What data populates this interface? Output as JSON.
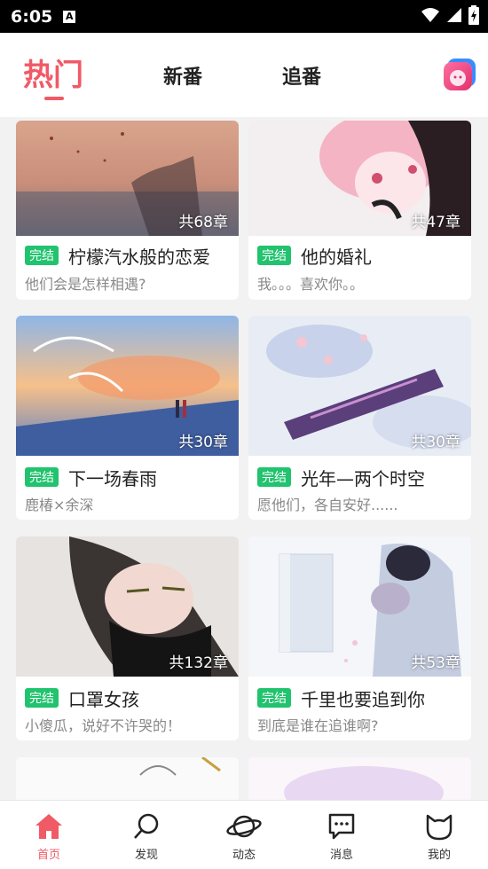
{
  "status": {
    "time": "6:05",
    "notification_icon": "A"
  },
  "tabs": {
    "hot": "热门",
    "new": "新番",
    "follow": "追番"
  },
  "cards": [
    {
      "count": "共68章",
      "badge": "完结",
      "title": "柠檬汽水般的恋爱",
      "subtitle": "他们会是怎样相遇?"
    },
    {
      "count": "共47章",
      "badge": "完结",
      "title": "他的婚礼",
      "subtitle": "我。。。喜欢你。。"
    },
    {
      "count": "共30章",
      "badge": "完结",
      "title": "下一场春雨",
      "subtitle": "鹿椿×余深"
    },
    {
      "count": "共30章",
      "badge": "完结",
      "title": "光年—两个时空",
      "subtitle": "愿他们，各自安好......"
    },
    {
      "count": "共132章",
      "badge": "完结",
      "title": "口罩女孩",
      "subtitle": "小傻瓜，说好不许哭的！"
    },
    {
      "count": "共53章",
      "badge": "完结",
      "title": "千里也要追到你",
      "subtitle": "到底是谁在追谁啊?"
    }
  ],
  "nav": {
    "home": "首页",
    "discover": "发现",
    "feed": "动态",
    "messages": "消息",
    "mine": "我的"
  },
  "colors": {
    "accent": "#f05a66",
    "badge": "#21c36e"
  }
}
